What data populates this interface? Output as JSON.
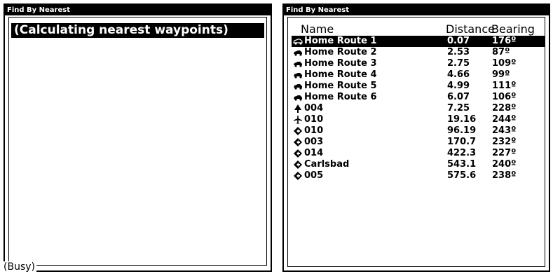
{
  "left_screen": {
    "title": "Find By Nearest",
    "message": "(Calculating nearest waypoints)",
    "status": "(Busy)"
  },
  "right_screen": {
    "title": "Find By Nearest",
    "columns": {
      "name": "Name",
      "distance": "Distance",
      "bearing": "Bearing"
    },
    "rows": [
      {
        "icon": "car-outline-icon",
        "name": "Home Route 1",
        "distance": "0.07",
        "bearing": "176º"
      },
      {
        "icon": "car-icon",
        "name": "Home Route 2",
        "distance": "2.53",
        "bearing": "87º"
      },
      {
        "icon": "car-icon",
        "name": "Home Route 3",
        "distance": "2.75",
        "bearing": "109º"
      },
      {
        "icon": "car-icon",
        "name": "Home Route 4",
        "distance": "4.66",
        "bearing": "99º"
      },
      {
        "icon": "car-icon",
        "name": "Home Route 5",
        "distance": "4.99",
        "bearing": "111º"
      },
      {
        "icon": "car-icon",
        "name": "Home Route 6",
        "distance": "6.07",
        "bearing": "106º"
      },
      {
        "icon": "tree-icon",
        "name": "004",
        "distance": "7.25",
        "bearing": "228º"
      },
      {
        "icon": "airport-icon",
        "name": "010",
        "distance": "19.16",
        "bearing": "244º"
      },
      {
        "icon": "diamond-waypoint-icon",
        "name": "010",
        "distance": "96.19",
        "bearing": "243º"
      },
      {
        "icon": "diamond-waypoint-icon",
        "name": "003",
        "distance": "170.7",
        "bearing": "232º"
      },
      {
        "icon": "diamond-waypoint-icon",
        "name": "014",
        "distance": "422.3",
        "bearing": "227º"
      },
      {
        "icon": "diamond-waypoint-icon",
        "name": "Carlsbad",
        "distance": "543.1",
        "bearing": "240º"
      },
      {
        "icon": "diamond-waypoint-icon",
        "name": "005",
        "distance": "575.6",
        "bearing": "238º"
      }
    ],
    "selected_index": 0
  }
}
